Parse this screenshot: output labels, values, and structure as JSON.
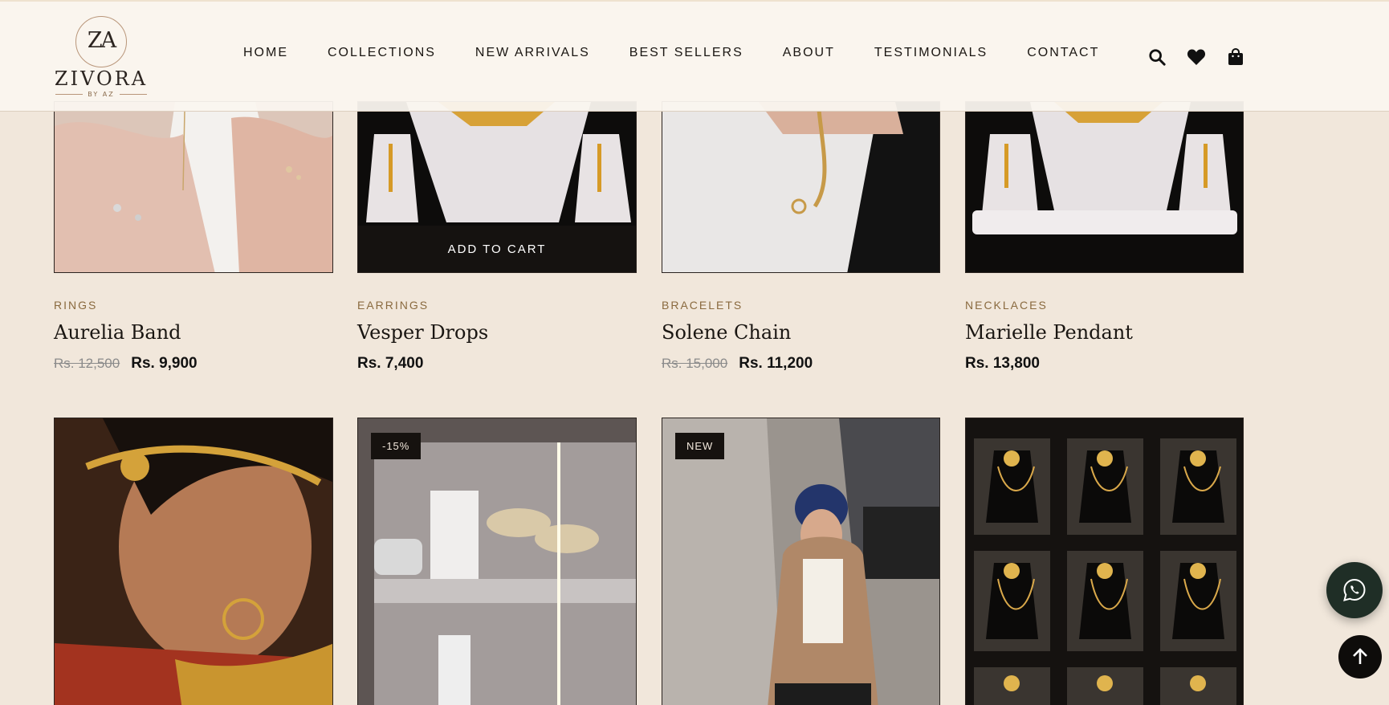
{
  "brand": {
    "monogram": "ZA",
    "name": "ZIVORA",
    "sub": "BY AZ"
  },
  "nav": [
    "HOME",
    "COLLECTIONS",
    "NEW ARRIVALS",
    "BEST SELLERS",
    "ABOUT",
    "TESTIMONIALS",
    "CONTACT"
  ],
  "header_icons": [
    "search-icon",
    "heart-icon",
    "bag-icon"
  ],
  "products_row1": [
    {
      "category": "RINGS",
      "name": "Aurelia Band",
      "old_price": "Rs. 12,500",
      "price": "Rs. 9,900"
    },
    {
      "category": "EARRINGS",
      "name": "Vesper Drops",
      "old_price": "",
      "price": "Rs. 7,400",
      "cta": "ADD TO CART"
    },
    {
      "category": "BRACELETS",
      "name": "Solene Chain",
      "old_price": "Rs. 15,000",
      "price": "Rs. 11,200"
    },
    {
      "category": "NECKLACES",
      "name": "Marielle Pendant",
      "old_price": "",
      "price": "Rs. 13,800"
    }
  ],
  "products_row2_badges": [
    "",
    "-15%",
    "NEW",
    ""
  ],
  "floating": {
    "whatsapp_icon": "whatsapp-icon",
    "top_icon": "arrow-up-icon"
  },
  "colors": {
    "background": "#f1e7db",
    "accent": "#8a6a3f",
    "dark": "#151210"
  }
}
